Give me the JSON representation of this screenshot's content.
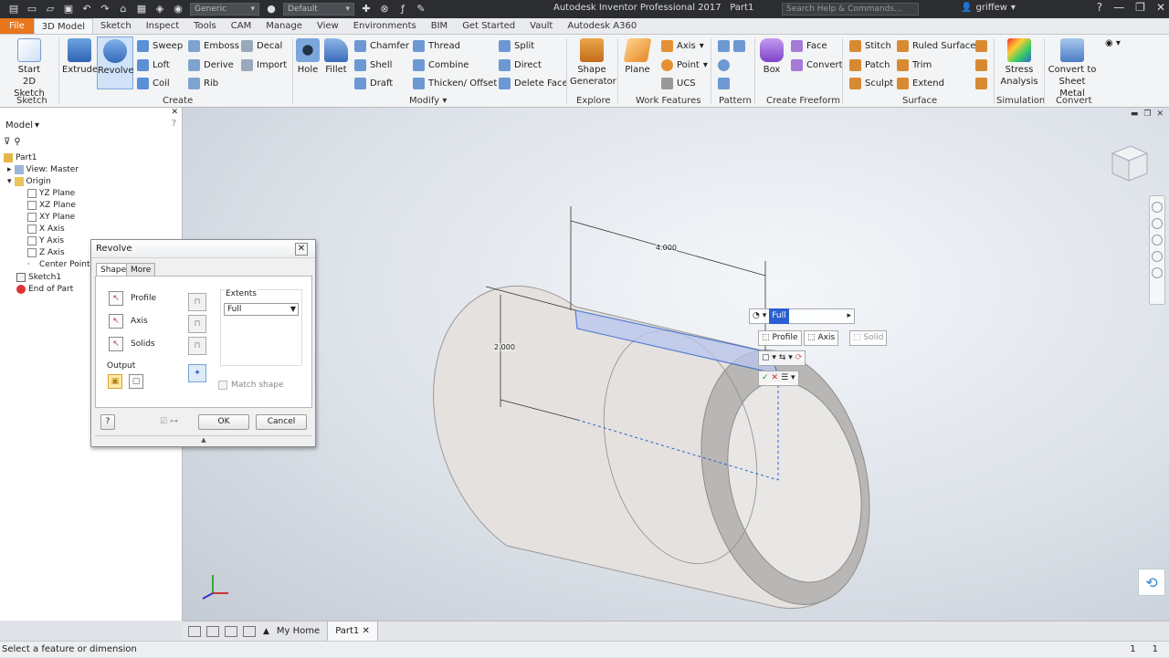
{
  "titlebar": {
    "app_title": "Autodesk Inventor Professional 2017",
    "doc_name": "Part1",
    "search_placeholder": "Search Help & Commands...",
    "user": "griffew",
    "material_value": "Generic",
    "appearance_value": "Default"
  },
  "tabs": [
    "File",
    "3D Model",
    "Sketch",
    "Inspect",
    "Tools",
    "CAM",
    "Manage",
    "View",
    "Environments",
    "BIM",
    "Get Started",
    "Vault",
    "Autodesk A360"
  ],
  "ribbon": {
    "sketch": {
      "start_label_1": "Start",
      "start_label_2": "2D Sketch",
      "panel": "Sketch"
    },
    "create": {
      "extrude": "Extrude",
      "revolve": "Revolve",
      "sweep": "Sweep",
      "loft": "Loft",
      "coil": "Coil",
      "emboss": "Emboss",
      "derive": "Derive",
      "rib": "Rib",
      "decal": "Decal",
      "import": "Import",
      "panel": "Create"
    },
    "modify": {
      "hole": "Hole",
      "fillet": "Fillet",
      "chamfer": "Chamfer",
      "shell": "Shell",
      "draft": "Draft",
      "thread": "Thread",
      "combine": "Combine",
      "thicken": "Thicken/ Offset",
      "split": "Split",
      "direct": "Direct",
      "delete_face": "Delete Face",
      "panel": "Modify"
    },
    "explore": {
      "shape_gen_1": "Shape",
      "shape_gen_2": "Generator",
      "panel": "Explore"
    },
    "work": {
      "plane": "Plane",
      "axis": "Axis",
      "point": "Point",
      "ucs": "UCS",
      "panel": "Work Features"
    },
    "pattern": {
      "panel": "Pattern"
    },
    "freeform": {
      "box": "Box",
      "face": "Face",
      "convert": "Convert",
      "panel": "Create Freeform"
    },
    "surface": {
      "stitch": "Stitch",
      "patch": "Patch",
      "sculpt": "Sculpt",
      "ruled": "Ruled Surface",
      "trim": "Trim",
      "extend": "Extend",
      "panel": "Surface"
    },
    "simulation": {
      "stress_1": "Stress",
      "stress_2": "Analysis",
      "panel": "Simulation"
    },
    "convert": {
      "sheet_1": "Convert to",
      "sheet_2": "Sheet Metal",
      "panel": "Convert"
    }
  },
  "browser": {
    "title": "Model",
    "items": [
      {
        "label": "Part1",
        "indent": 0
      },
      {
        "label": "View: Master",
        "indent": 1
      },
      {
        "label": "Origin",
        "indent": 1
      },
      {
        "label": "YZ Plane",
        "indent": 2
      },
      {
        "label": "XZ Plane",
        "indent": 2
      },
      {
        "label": "XY Plane",
        "indent": 2
      },
      {
        "label": "X Axis",
        "indent": 2
      },
      {
        "label": "Y Axis",
        "indent": 2
      },
      {
        "label": "Z Axis",
        "indent": 2
      },
      {
        "label": "Center Point",
        "indent": 2
      },
      {
        "label": "Sketch1",
        "indent": 1
      },
      {
        "label": "End of Part",
        "indent": 1
      }
    ]
  },
  "dialog": {
    "title": "Revolve",
    "tab_shape": "Shape",
    "tab_more": "More",
    "profile": "Profile",
    "axis": "Axis",
    "solids": "Solids",
    "output": "Output",
    "extents": "Extents",
    "extents_value": "Full",
    "match_shape": "Match shape",
    "ok": "OK",
    "cancel": "Cancel"
  },
  "minitoolbar": {
    "extents_value": "Full",
    "profile": "Profile",
    "axis": "Axis",
    "solid": "Solid"
  },
  "dimensions": {
    "length": "4.000",
    "height": "2.000"
  },
  "doc_tabs": {
    "home": "My Home",
    "part": "Part1"
  },
  "status": {
    "message": "Select a feature or dimension",
    "count1": "1",
    "count2": "1"
  },
  "colors": {
    "accent": "#e8761c",
    "selection": "#2a5fd0",
    "titlebar": "#2b2d30"
  }
}
